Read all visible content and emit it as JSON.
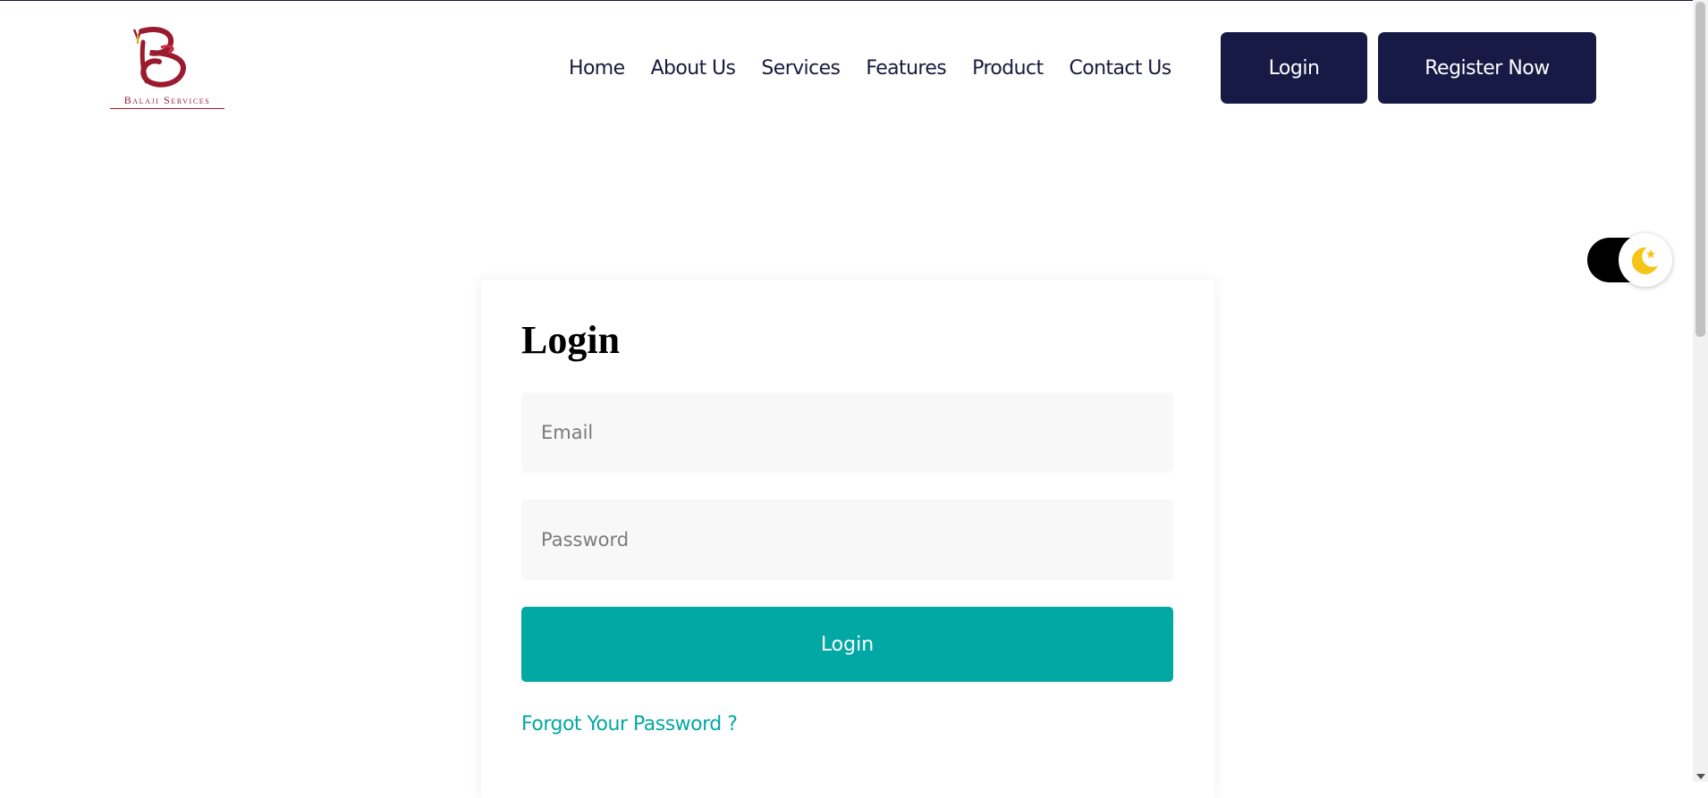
{
  "brand": {
    "name": "Balaji Services",
    "color": "#9b1b2e"
  },
  "nav": {
    "items": [
      {
        "label": "Home"
      },
      {
        "label": "About Us"
      },
      {
        "label": "Services"
      },
      {
        "label": "Features"
      },
      {
        "label": "Product"
      },
      {
        "label": "Contact Us"
      }
    ],
    "login_label": "Login",
    "register_label": "Register Now",
    "button_color": "#171a45"
  },
  "theme_toggle": {
    "icon": "moon-star-icon",
    "mode": "light"
  },
  "login_form": {
    "title": "Login",
    "email_placeholder": "Email",
    "password_placeholder": "Password",
    "submit_label": "Login",
    "forgot_label": "Forgot Your Password ?",
    "accent_color": "#02a8a4"
  }
}
